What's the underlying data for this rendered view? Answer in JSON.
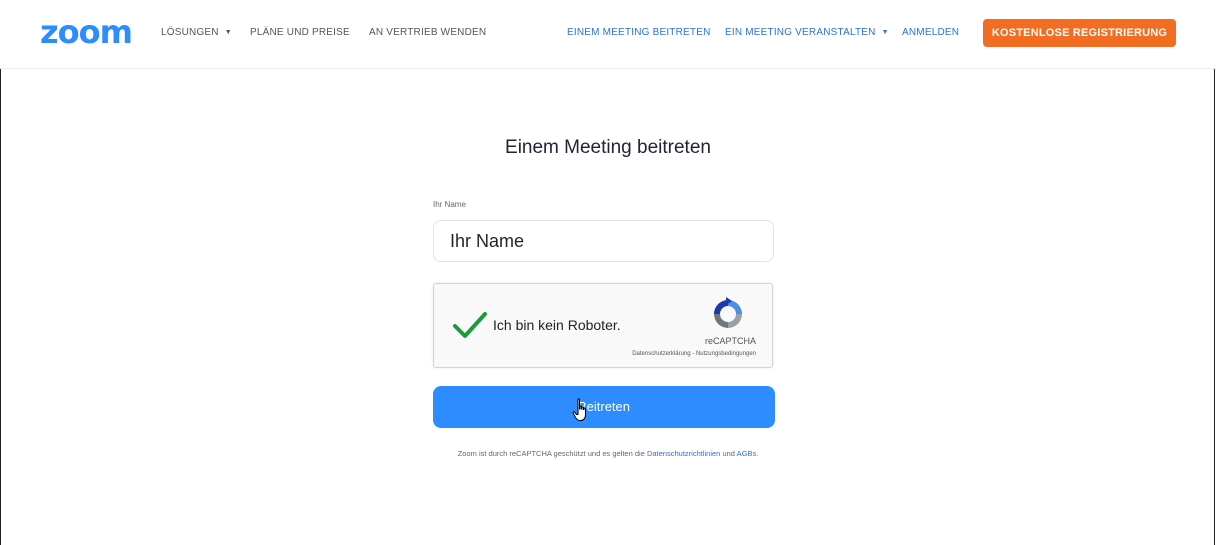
{
  "header": {
    "logo": "zoom",
    "nav_left": [
      {
        "label": "LÖSUNGEN",
        "dropdown": true
      },
      {
        "label": "PLÄNE UND PREISE",
        "dropdown": false
      },
      {
        "label": "AN VERTRIEB WENDEN",
        "dropdown": false
      }
    ],
    "nav_right": [
      {
        "label": "EINEM MEETING BEITRETEN",
        "dropdown": false
      },
      {
        "label": "EIN MEETING VERANSTALTEN",
        "dropdown": true
      },
      {
        "label": "ANMELDEN",
        "dropdown": false
      }
    ],
    "signup_label": "KOSTENLOSE REGISTRIERUNG"
  },
  "main": {
    "title": "Einem Meeting beitreten",
    "name_label": "Ihr Name",
    "name_placeholder": "Ihr Name",
    "recaptcha": {
      "label": "Ich bin kein Roboter.",
      "checked": true,
      "brand": "reCAPTCHA",
      "privacy_link": "Datenschutzerklärung",
      "separator": "-",
      "terms_link": "Nutzungsbedingungen"
    },
    "join_label": "Beitreten",
    "footer": {
      "prefix": "Zoom ist durch reCAPTCHA geschützt und es gelten die",
      "privacy_link": "Datenschutzrichtlinien",
      "conjunction": "und",
      "terms_link": "AGBs",
      "suffix": "."
    }
  },
  "colors": {
    "brand_blue": "#2d8cff",
    "link_blue": "#2d6fe0",
    "signup_orange": "#f26d21",
    "check_green": "#1a9c3c"
  }
}
